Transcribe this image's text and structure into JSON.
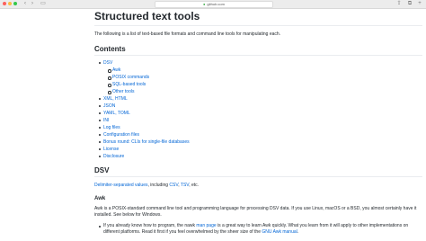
{
  "browser": {
    "address": "github.com"
  },
  "page": {
    "title": "Structured text tools",
    "intro": "The following is a list of text-based file formats and command line tools for manipulating each.",
    "contents_heading": "Contents",
    "toc": [
      {
        "label": "DSV",
        "level": 1
      },
      {
        "label": "Awk",
        "level": 2
      },
      {
        "label": "POSIX commands",
        "level": 2
      },
      {
        "label": "SQL-based tools",
        "level": 2
      },
      {
        "label": "Other tools",
        "level": 2
      },
      {
        "label": "XML, HTML",
        "level": 1
      },
      {
        "label": "JSON",
        "level": 1
      },
      {
        "label": "YAML, TOML",
        "level": 1
      },
      {
        "label": "INI",
        "level": 1
      },
      {
        "label": "Log files",
        "level": 1
      },
      {
        "label": "Configuration files",
        "level": 1
      },
      {
        "label": "Bonus round: CLIs for single-file databases",
        "level": 1
      },
      {
        "label": "License",
        "level": 1
      },
      {
        "label": "Disclosure",
        "level": 1
      }
    ],
    "dsv_heading": "DSV",
    "dsv_line": {
      "link1": "Delimiter-separated values",
      "text1": ", including ",
      "link2": "CSV",
      "text2": ", ",
      "link3": "TSV",
      "text3": ", etc."
    },
    "awk_heading": "Awk",
    "awk_paragraph": "Awk is a POSIX-standard command line tool and programming language for processing DSV data. If you use Linux, macOS or a BSD, you almost certainly have it installed. See below for Windows.",
    "bullet1": {
      "text1": "If you already know how to program, the nawk ",
      "link1": "man page",
      "text2": " is a great way to learn Awk quickly. What you learn from it will apply to other implementations on different platforms. Read it first if you feel overwhelmed by the sheer size of the ",
      "link2": "GNU Awk manual",
      "text3": "."
    }
  },
  "colors": {
    "link": "#0366d6",
    "text": "#24292e",
    "rule": "#eaecef"
  }
}
